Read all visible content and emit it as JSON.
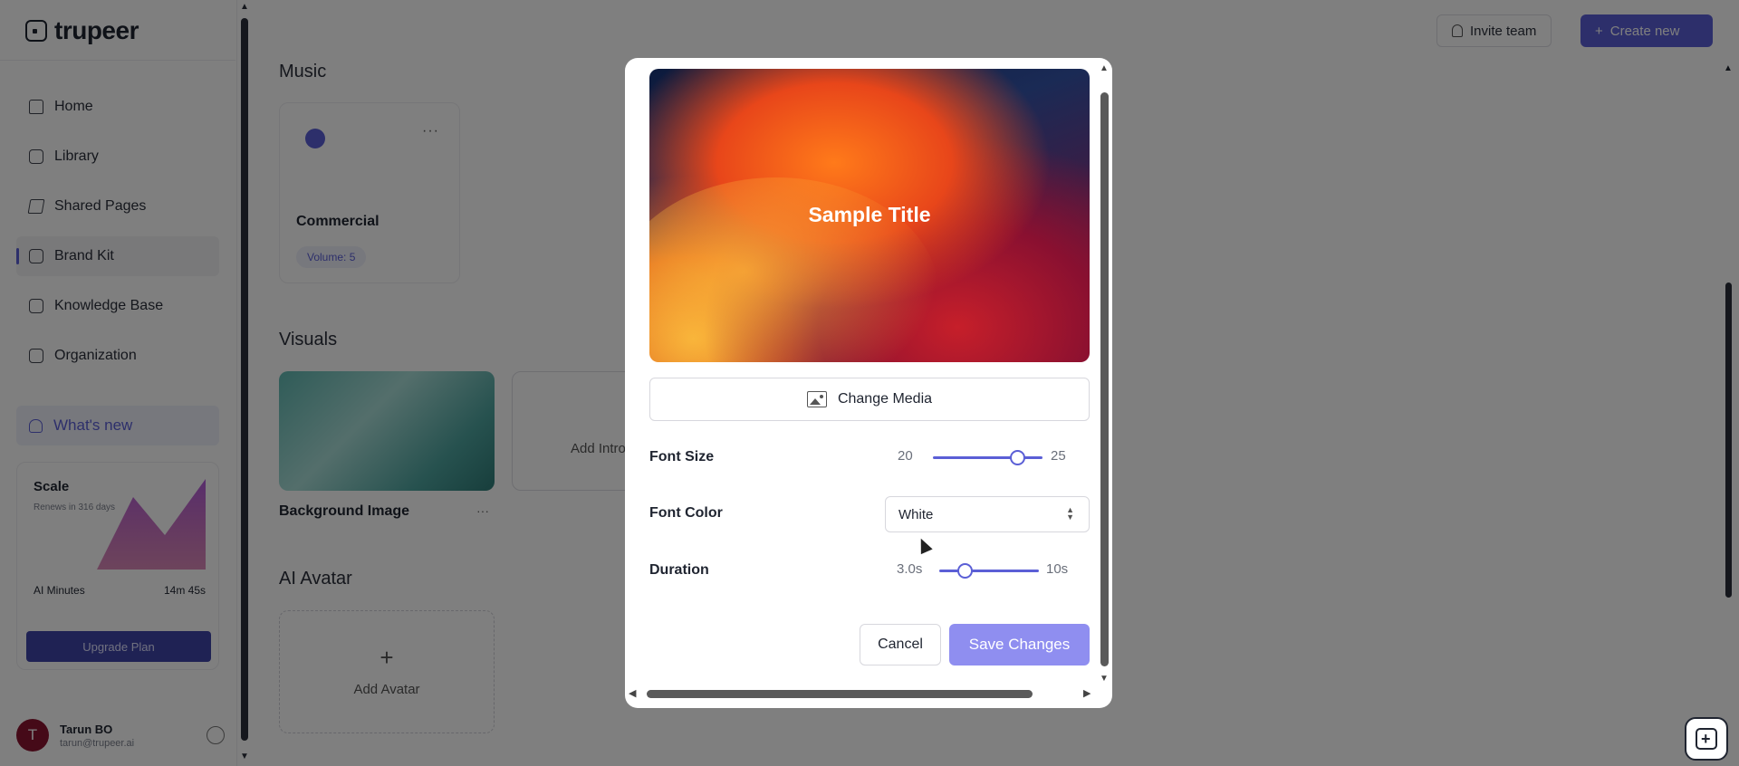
{
  "app": {
    "logo_text": "trupeer"
  },
  "sidebar": {
    "items": [
      {
        "label": "Home",
        "icon": "home-icon"
      },
      {
        "label": "Library",
        "icon": "library-icon"
      },
      {
        "label": "Shared Pages",
        "icon": "stack-icon"
      },
      {
        "label": "Brand Kit",
        "icon": "brand-kit-icon",
        "active": true
      },
      {
        "label": "Knowledge Base",
        "icon": "book-icon"
      },
      {
        "label": "Organization",
        "icon": "organization-icon"
      }
    ],
    "whats_new": "What's new",
    "plan": {
      "name": "Scale",
      "renews": "Renews in 316 days",
      "minutes_label": "AI Minutes",
      "minutes_value": "14m 45s",
      "upgrade_label": "Upgrade Plan"
    },
    "user": {
      "initial": "T",
      "name": "Tarun BO",
      "email": "tarun@trupeer.ai"
    }
  },
  "header": {
    "invite_label": "Invite team",
    "create_label": "Create new"
  },
  "main": {
    "music": {
      "title": "Music",
      "card": {
        "name": "Commercial",
        "volume": "Volume: 5"
      }
    },
    "visuals": {
      "title": "Visuals",
      "background_label": "Background Image",
      "intro_label": "Add Intro"
    },
    "ai_avatar": {
      "title": "AI Avatar",
      "add_label": "Add Avatar"
    }
  },
  "dialog": {
    "preview_title": "Sample Title",
    "change_media_label": "Change Media",
    "font_size": {
      "label": "Font Size",
      "min": "20",
      "max": "25",
      "value_fraction": 0.77
    },
    "font_color": {
      "label": "Font Color",
      "selected": "White"
    },
    "duration": {
      "label": "Duration",
      "value": "3.0s",
      "max": "10s",
      "value_fraction": 0.25
    },
    "cancel_label": "Cancel",
    "save_label": "Save Changes"
  },
  "colors": {
    "accent": "#5b5fd6",
    "save_button": "#8f8ef0",
    "upgrade_button": "#3f44a8",
    "avatar": "#8b1530"
  }
}
